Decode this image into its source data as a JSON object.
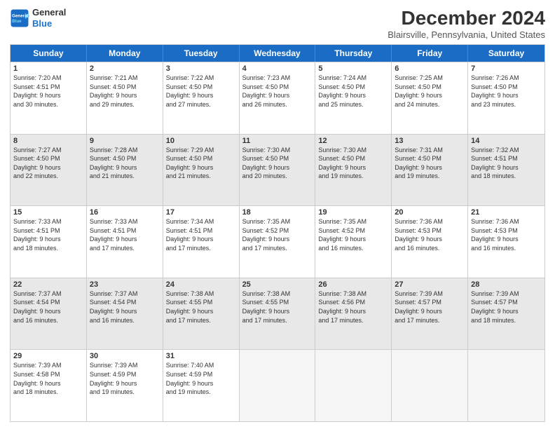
{
  "header": {
    "logo_line1": "General",
    "logo_line2": "Blue",
    "main_title": "December 2024",
    "subtitle": "Blairsville, Pennsylvania, United States"
  },
  "calendar": {
    "days_of_week": [
      "Sunday",
      "Monday",
      "Tuesday",
      "Wednesday",
      "Thursday",
      "Friday",
      "Saturday"
    ],
    "rows": [
      [
        {
          "num": "1",
          "info": "Sunrise: 7:20 AM\nSunset: 4:51 PM\nDaylight: 9 hours\nand 30 minutes.",
          "shaded": false,
          "empty": false
        },
        {
          "num": "2",
          "info": "Sunrise: 7:21 AM\nSunset: 4:50 PM\nDaylight: 9 hours\nand 29 minutes.",
          "shaded": false,
          "empty": false
        },
        {
          "num": "3",
          "info": "Sunrise: 7:22 AM\nSunset: 4:50 PM\nDaylight: 9 hours\nand 27 minutes.",
          "shaded": false,
          "empty": false
        },
        {
          "num": "4",
          "info": "Sunrise: 7:23 AM\nSunset: 4:50 PM\nDaylight: 9 hours\nand 26 minutes.",
          "shaded": false,
          "empty": false
        },
        {
          "num": "5",
          "info": "Sunrise: 7:24 AM\nSunset: 4:50 PM\nDaylight: 9 hours\nand 25 minutes.",
          "shaded": false,
          "empty": false
        },
        {
          "num": "6",
          "info": "Sunrise: 7:25 AM\nSunset: 4:50 PM\nDaylight: 9 hours\nand 24 minutes.",
          "shaded": false,
          "empty": false
        },
        {
          "num": "7",
          "info": "Sunrise: 7:26 AM\nSunset: 4:50 PM\nDaylight: 9 hours\nand 23 minutes.",
          "shaded": false,
          "empty": false
        }
      ],
      [
        {
          "num": "8",
          "info": "Sunrise: 7:27 AM\nSunset: 4:50 PM\nDaylight: 9 hours\nand 22 minutes.",
          "shaded": true,
          "empty": false
        },
        {
          "num": "9",
          "info": "Sunrise: 7:28 AM\nSunset: 4:50 PM\nDaylight: 9 hours\nand 21 minutes.",
          "shaded": true,
          "empty": false
        },
        {
          "num": "10",
          "info": "Sunrise: 7:29 AM\nSunset: 4:50 PM\nDaylight: 9 hours\nand 21 minutes.",
          "shaded": true,
          "empty": false
        },
        {
          "num": "11",
          "info": "Sunrise: 7:30 AM\nSunset: 4:50 PM\nDaylight: 9 hours\nand 20 minutes.",
          "shaded": true,
          "empty": false
        },
        {
          "num": "12",
          "info": "Sunrise: 7:30 AM\nSunset: 4:50 PM\nDaylight: 9 hours\nand 19 minutes.",
          "shaded": true,
          "empty": false
        },
        {
          "num": "13",
          "info": "Sunrise: 7:31 AM\nSunset: 4:50 PM\nDaylight: 9 hours\nand 19 minutes.",
          "shaded": true,
          "empty": false
        },
        {
          "num": "14",
          "info": "Sunrise: 7:32 AM\nSunset: 4:51 PM\nDaylight: 9 hours\nand 18 minutes.",
          "shaded": true,
          "empty": false
        }
      ],
      [
        {
          "num": "15",
          "info": "Sunrise: 7:33 AM\nSunset: 4:51 PM\nDaylight: 9 hours\nand 18 minutes.",
          "shaded": false,
          "empty": false
        },
        {
          "num": "16",
          "info": "Sunrise: 7:33 AM\nSunset: 4:51 PM\nDaylight: 9 hours\nand 17 minutes.",
          "shaded": false,
          "empty": false
        },
        {
          "num": "17",
          "info": "Sunrise: 7:34 AM\nSunset: 4:51 PM\nDaylight: 9 hours\nand 17 minutes.",
          "shaded": false,
          "empty": false
        },
        {
          "num": "18",
          "info": "Sunrise: 7:35 AM\nSunset: 4:52 PM\nDaylight: 9 hours\nand 17 minutes.",
          "shaded": false,
          "empty": false
        },
        {
          "num": "19",
          "info": "Sunrise: 7:35 AM\nSunset: 4:52 PM\nDaylight: 9 hours\nand 16 minutes.",
          "shaded": false,
          "empty": false
        },
        {
          "num": "20",
          "info": "Sunrise: 7:36 AM\nSunset: 4:53 PM\nDaylight: 9 hours\nand 16 minutes.",
          "shaded": false,
          "empty": false
        },
        {
          "num": "21",
          "info": "Sunrise: 7:36 AM\nSunset: 4:53 PM\nDaylight: 9 hours\nand 16 minutes.",
          "shaded": false,
          "empty": false
        }
      ],
      [
        {
          "num": "22",
          "info": "Sunrise: 7:37 AM\nSunset: 4:54 PM\nDaylight: 9 hours\nand 16 minutes.",
          "shaded": true,
          "empty": false
        },
        {
          "num": "23",
          "info": "Sunrise: 7:37 AM\nSunset: 4:54 PM\nDaylight: 9 hours\nand 16 minutes.",
          "shaded": true,
          "empty": false
        },
        {
          "num": "24",
          "info": "Sunrise: 7:38 AM\nSunset: 4:55 PM\nDaylight: 9 hours\nand 17 minutes.",
          "shaded": true,
          "empty": false
        },
        {
          "num": "25",
          "info": "Sunrise: 7:38 AM\nSunset: 4:55 PM\nDaylight: 9 hours\nand 17 minutes.",
          "shaded": true,
          "empty": false
        },
        {
          "num": "26",
          "info": "Sunrise: 7:38 AM\nSunset: 4:56 PM\nDaylight: 9 hours\nand 17 minutes.",
          "shaded": true,
          "empty": false
        },
        {
          "num": "27",
          "info": "Sunrise: 7:39 AM\nSunset: 4:57 PM\nDaylight: 9 hours\nand 17 minutes.",
          "shaded": true,
          "empty": false
        },
        {
          "num": "28",
          "info": "Sunrise: 7:39 AM\nSunset: 4:57 PM\nDaylight: 9 hours\nand 18 minutes.",
          "shaded": true,
          "empty": false
        }
      ],
      [
        {
          "num": "29",
          "info": "Sunrise: 7:39 AM\nSunset: 4:58 PM\nDaylight: 9 hours\nand 18 minutes.",
          "shaded": false,
          "empty": false
        },
        {
          "num": "30",
          "info": "Sunrise: 7:39 AM\nSunset: 4:59 PM\nDaylight: 9 hours\nand 19 minutes.",
          "shaded": false,
          "empty": false
        },
        {
          "num": "31",
          "info": "Sunrise: 7:40 AM\nSunset: 4:59 PM\nDaylight: 9 hours\nand 19 minutes.",
          "shaded": false,
          "empty": false
        },
        {
          "num": "",
          "info": "",
          "shaded": false,
          "empty": true
        },
        {
          "num": "",
          "info": "",
          "shaded": false,
          "empty": true
        },
        {
          "num": "",
          "info": "",
          "shaded": false,
          "empty": true
        },
        {
          "num": "",
          "info": "",
          "shaded": false,
          "empty": true
        }
      ]
    ]
  }
}
